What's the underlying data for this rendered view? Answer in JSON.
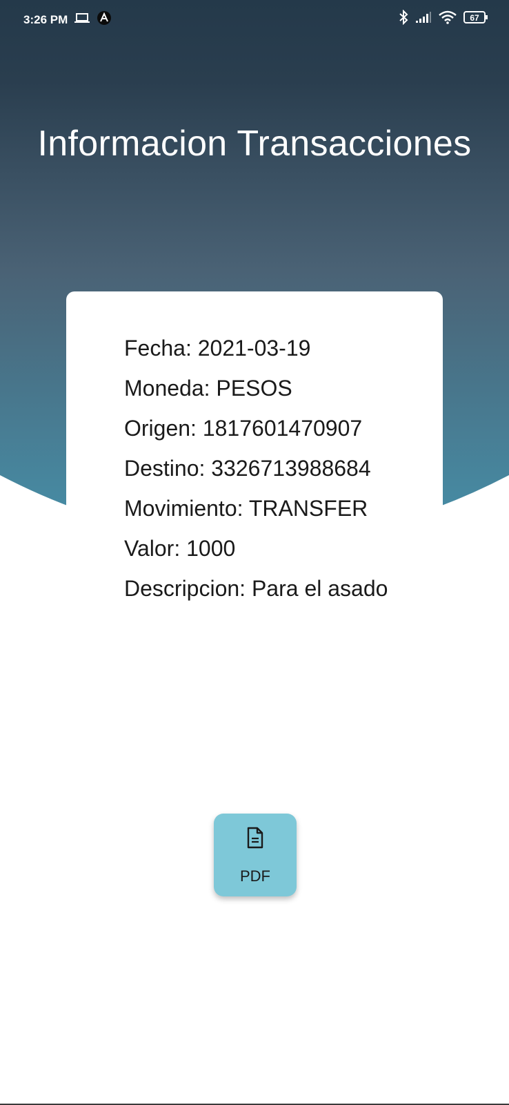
{
  "status_bar": {
    "time": "3:26 PM",
    "icons_left": [
      "laptop-icon",
      "app-a-icon"
    ],
    "icons_right": [
      "bluetooth-icon",
      "signal-icon",
      "wifi-icon",
      "battery-icon"
    ],
    "battery": "67"
  },
  "header": {
    "title": "Informacion Transacciones",
    "gradient_top": "#24394a",
    "gradient_bottom": "#4690a9"
  },
  "transaction": {
    "fecha": "Fecha: 2021-03-19",
    "moneda": "Moneda: PESOS",
    "origen": "Origen: 1817601470907",
    "destino": "Destino: 3326713988684",
    "movimiento": "Movimiento: TRANSFER",
    "valor": "Valor: 1000",
    "descripcion": "Descripcion: Para el asado"
  },
  "actions": {
    "pdf_label": "PDF",
    "pdf_icon": "document-icon",
    "pdf_color": "#7ec8d8"
  }
}
